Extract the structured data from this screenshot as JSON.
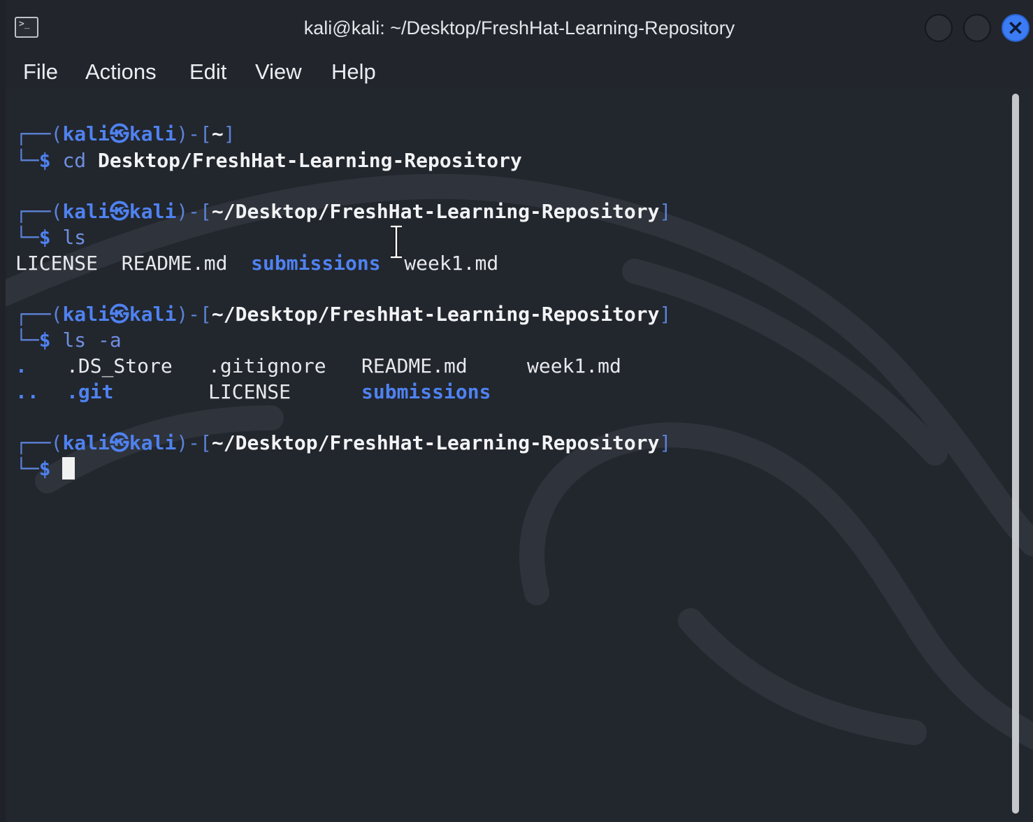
{
  "window": {
    "title": "kali@kali: ~/Desktop/FreshHat-Learning-Repository",
    "icon": "terminal-icon",
    "close_glyph": "✕"
  },
  "menu": [
    "File",
    "Actions",
    "Edit",
    "View",
    "Help"
  ],
  "terminal": {
    "user": "kali",
    "host": "kali",
    "at_symbol": "㉿",
    "prompt_symbol": "$",
    "blocks": [
      {
        "cwd": "~",
        "command": "cd",
        "args": "Desktop/FreshHat-Learning-Repository"
      },
      {
        "cwd": "~/Desktop/FreshHat-Learning-Repository",
        "command": "ls",
        "output": {
          "f1": "LICENSE",
          "f2": "README.md",
          "d1": "submissions",
          "f3": "week1.md"
        }
      },
      {
        "cwd": "~/Desktop/FreshHat-Learning-Repository",
        "command": "ls -a",
        "output": {
          "r1c1": ".",
          "r1c2": ".DS_Store",
          "r1c3": ".gitignore",
          "r1c4": "README.md",
          "r1c5": "week1.md",
          "r2c1": "..",
          "r2c2": ".git",
          "r2c3": "LICENSE",
          "r2c4": "submissions"
        }
      },
      {
        "cwd": "~/Desktop/FreshHat-Learning-Repository"
      }
    ]
  },
  "colors": {
    "background": "#22262d",
    "prompt_blue": "#4f82f0",
    "close_button": "#3b7cf5"
  }
}
